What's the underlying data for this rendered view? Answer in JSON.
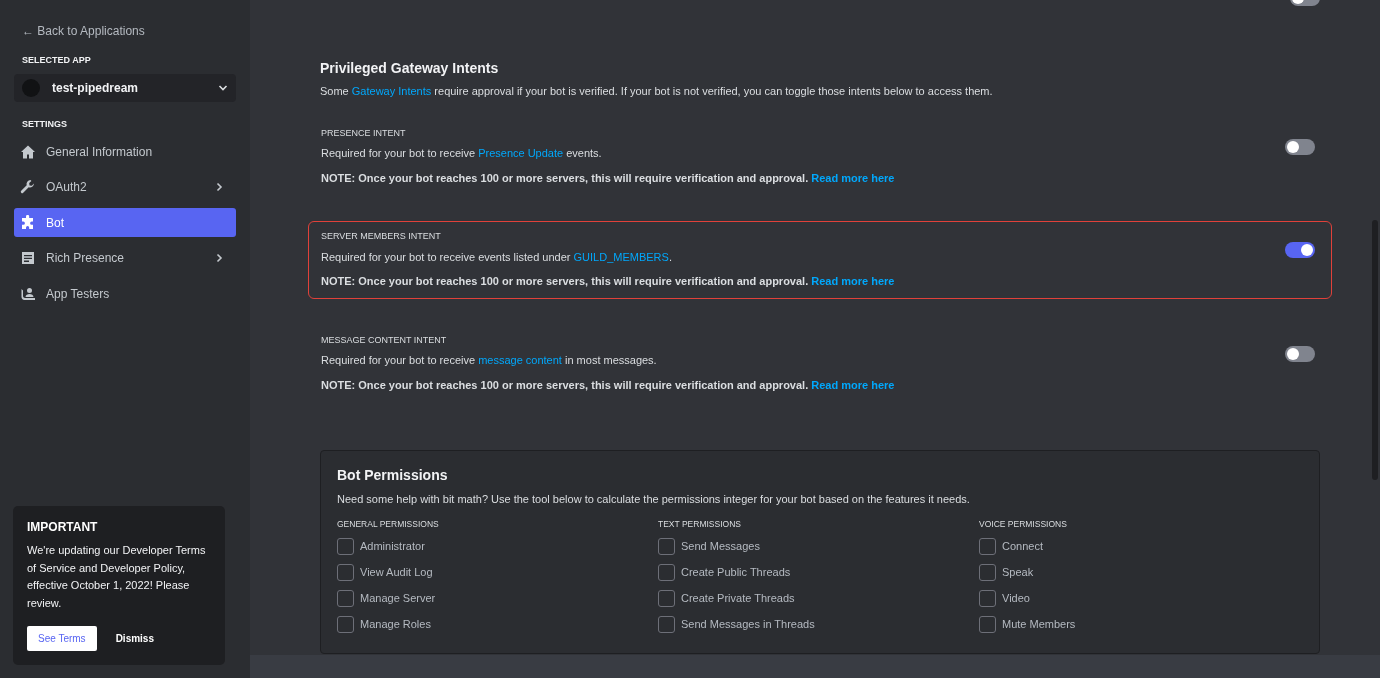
{
  "sidebar": {
    "back_link": "← Back to Applications",
    "selected_app_label": "SELECTED APP",
    "app_name": "test-pipedream",
    "settings_label": "SETTINGS",
    "items": [
      {
        "label": "General Information",
        "selected": false,
        "has_submenu": false
      },
      {
        "label": "OAuth2",
        "selected": false,
        "has_submenu": true
      },
      {
        "label": "Bot",
        "selected": true,
        "has_submenu": false
      },
      {
        "label": "Rich Presence",
        "selected": false,
        "has_submenu": true
      },
      {
        "label": "App Testers",
        "selected": false,
        "has_submenu": false
      }
    ],
    "notice": {
      "title": "IMPORTANT",
      "text": "We're updating our Developer Terms of Service and Developer Policy, effective October 1, 2022! Please review.",
      "primary_button": "See Terms",
      "secondary_button": "Dismiss"
    }
  },
  "top_toggle": {
    "on": false
  },
  "intents_section": {
    "title": "Privileged Gateway Intents",
    "description_before": "Some ",
    "description_link": "Gateway Intents",
    "description_after": " require approval if your bot is verified. If your bot is not verified, you can toggle those intents below to access them.",
    "intents": [
      {
        "label": "PRESENCE INTENT",
        "text_before": "Required for your bot to receive ",
        "link": "Presence Update",
        "text_after": " events.",
        "note": "NOTE: Once your bot reaches 100 or more servers, this will require verification and approval.",
        "note_link": "Read more here",
        "on": false,
        "highlighted": false
      },
      {
        "label": "SERVER MEMBERS INTENT",
        "text_before": "Required for your bot to receive events listed under ",
        "link": "GUILD_MEMBERS",
        "text_after": ".",
        "note": "NOTE: Once your bot reaches 100 or more servers, this will require verification and approval.",
        "note_link": "Read more here",
        "on": true,
        "highlighted": true
      },
      {
        "label": "MESSAGE CONTENT INTENT",
        "text_before": "Required for your bot to receive ",
        "link": "message content",
        "text_after": " in most messages.",
        "note": "NOTE: Once your bot reaches 100 or more servers, this will require verification and approval.",
        "note_link": "Read more here",
        "on": false,
        "highlighted": false
      }
    ]
  },
  "permissions": {
    "title": "Bot Permissions",
    "description": "Need some help with bit math? Use the tool below to calculate the permissions integer for your bot based on the features it needs.",
    "groups": [
      {
        "heading": "GENERAL PERMISSIONS",
        "items": [
          {
            "label": "Administrator",
            "checked": false
          },
          {
            "label": "View Audit Log",
            "checked": false
          },
          {
            "label": "Manage Server",
            "checked": false
          },
          {
            "label": "Manage Roles",
            "checked": false
          }
        ]
      },
      {
        "heading": "TEXT PERMISSIONS",
        "items": [
          {
            "label": "Send Messages",
            "checked": false
          },
          {
            "label": "Create Public Threads",
            "checked": false
          },
          {
            "label": "Create Private Threads",
            "checked": false
          },
          {
            "label": "Send Messages in Threads",
            "checked": false
          }
        ]
      },
      {
        "heading": "VOICE PERMISSIONS",
        "items": [
          {
            "label": "Connect",
            "checked": false
          },
          {
            "label": "Speak",
            "checked": false
          },
          {
            "label": "Video",
            "checked": false
          },
          {
            "label": "Mute Members",
            "checked": false
          }
        ]
      }
    ]
  }
}
